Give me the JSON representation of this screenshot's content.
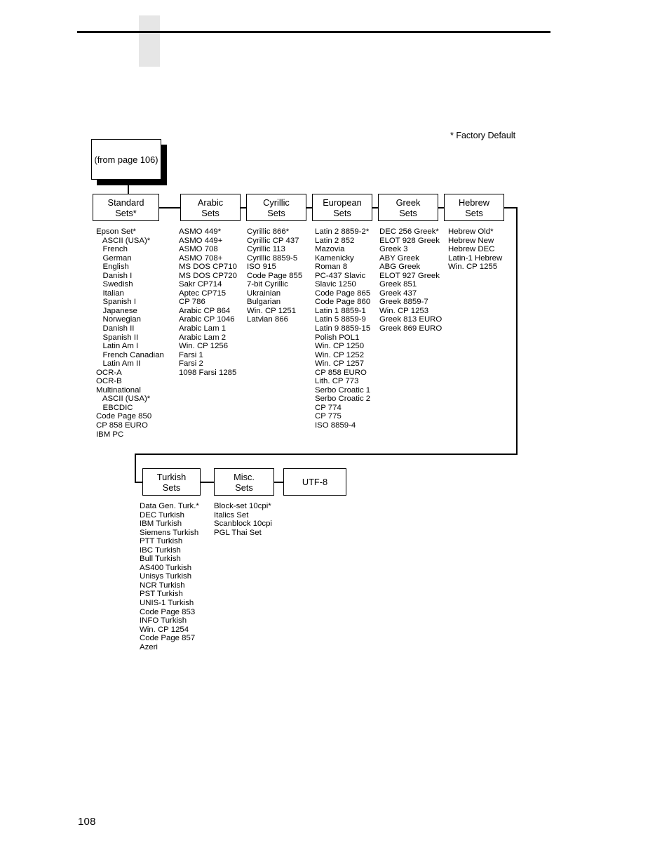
{
  "page": {
    "number": "108",
    "factory_default_note": "* Factory Default",
    "entry_box_label": "(from page 106)"
  },
  "diagram": {
    "row1": [
      {
        "id": "standard",
        "title_line1": "Standard",
        "title_line2": "Sets*",
        "items": [
          "Epson Set*",
          "   ASCII (USA)*",
          "   French",
          "   German",
          "   English",
          "   Danish I",
          "   Swedish",
          "   Italian",
          "   Spanish I",
          "   Japanese",
          "   Norwegian",
          "   Danish II",
          "   Spanish II",
          "   Latin Am I",
          "   French Canadian",
          "   Latin Am II",
          "OCR-A",
          "OCR-B",
          "Multinational",
          "   ASCII (USA)*",
          "   EBCDIC",
          "Code Page 850",
          "CP 858 EURO",
          "IBM PC"
        ]
      },
      {
        "id": "arabic",
        "title_line1": "Arabic",
        "title_line2": "Sets",
        "items": [
          "ASMO 449*",
          "ASMO 449+",
          "ASMO 708",
          "ASMO 708+",
          "MS DOS CP710",
          "MS DOS CP720",
          "Sakr CP714",
          "Aptec CP715",
          "CP 786",
          "Arabic CP 864",
          "Arabic CP 1046",
          "Arabic Lam 1",
          "Arabic Lam 2",
          "Win. CP 1256",
          "Farsi 1",
          "Farsi 2",
          "1098 Farsi 1285"
        ]
      },
      {
        "id": "cyrillic",
        "title_line1": "Cyrillic",
        "title_line2": "Sets",
        "items": [
          "Cyrillic 866*",
          "Cyrillic CP 437",
          "Cyrillic 113",
          "Cyrillic 8859-5",
          "ISO 915",
          "Code Page 855",
          "7-bit Cyrillic",
          "Ukrainian",
          "Bulgarian",
          "Win. CP 1251",
          "Latvian 866"
        ]
      },
      {
        "id": "european",
        "title_line1": "European",
        "title_line2": "Sets",
        "items": [
          "Latin 2 8859-2*",
          "Latin 2 852",
          "Mazovia",
          "Kamenicky",
          "Roman 8",
          "PC-437 Slavic",
          "Slavic 1250",
          "Code Page 865",
          "Code Page 860",
          "Latin 1 8859-1",
          "Latin 5 8859-9",
          "Latin 9 8859-15",
          "Polish POL1",
          "Win. CP 1250",
          "Win. CP 1252",
          "Win. CP 1257",
          "CP 858 EURO",
          "Lith. CP 773",
          "Serbo Croatic 1",
          "Serbo Croatic 2",
          "CP 774",
          "CP 775",
          "ISO 8859-4"
        ]
      },
      {
        "id": "greek",
        "title_line1": "Greek",
        "title_line2": "Sets",
        "items": [
          "DEC 256 Greek*",
          "ELOT 928 Greek",
          "Greek 3",
          "ABY Greek",
          "ABG Greek",
          "ELOT 927 Greek",
          "Greek 851",
          "Greek 437",
          "Greek 8859-7",
          "Win. CP 1253",
          "Greek 813 EURO",
          "Greek 869 EURO"
        ]
      },
      {
        "id": "hebrew",
        "title_line1": "Hebrew",
        "title_line2": "Sets",
        "items": [
          "Hebrew Old*",
          "Hebrew New",
          "Hebrew DEC",
          "Latin-1 Hebrew",
          "Win. CP 1255"
        ]
      }
    ],
    "row2": [
      {
        "id": "turkish",
        "title_line1": "Turkish",
        "title_line2": "Sets",
        "items": [
          "Data Gen. Turk.*",
          "DEC Turkish",
          "IBM Turkish",
          "Siemens Turkish",
          "PTT Turkish",
          "IBC Turkish",
          "Bull Turkish",
          "AS400 Turkish",
          "Unisys Turkish",
          "NCR Turkish",
          "PST Turkish",
          "UNIS-1 Turkish",
          "Code Page 853",
          "INFO Turkish",
          "Win. CP 1254",
          "Code Page 857",
          "Azeri"
        ]
      },
      {
        "id": "misc",
        "title_line1": "Misc.",
        "title_line2": "Sets",
        "items": [
          "Block-set 10cpi*",
          "Italics Set",
          "Scanblock 10cpi",
          "PGL Thai Set"
        ]
      },
      {
        "id": "utf8",
        "title_line1": "UTF-8",
        "title_line2": "",
        "items": []
      }
    ]
  }
}
